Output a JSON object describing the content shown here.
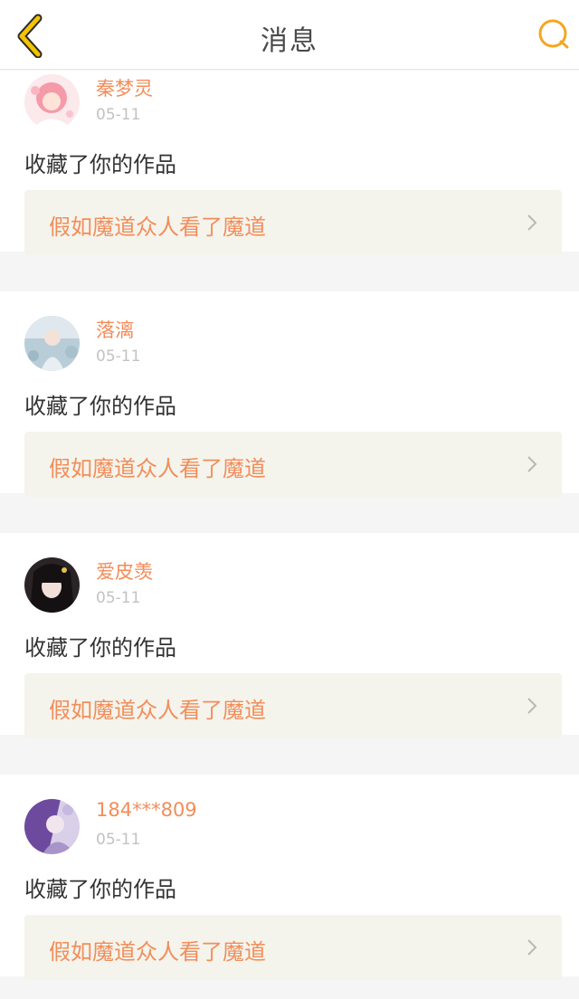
{
  "header": {
    "title": "消息",
    "back_icon": "chevron-left-icon",
    "search_icon": "search-icon",
    "accent_color": "#f5a623"
  },
  "colors": {
    "name": "#f28d5a",
    "work_title": "#f28d5a",
    "date": "#c2c2c2",
    "link_bg": "#f4f4ec",
    "page_bg": "#f5f5f5"
  },
  "messages": [
    {
      "user": "秦梦灵",
      "date": "05-11",
      "action": "收藏了你的作品",
      "work": "假如魔道众人看了魔道",
      "link_icon": "chevron-right-icon"
    },
    {
      "user": "落漓",
      "date": "05-11",
      "action": "收藏了你的作品",
      "work": "假如魔道众人看了魔道",
      "link_icon": "chevron-right-icon"
    },
    {
      "user": "爱皮羡",
      "date": "05-11",
      "action": "收藏了你的作品",
      "work": "假如魔道众人看了魔道",
      "link_icon": "chevron-right-icon"
    },
    {
      "user": "184***809",
      "date": "05-11",
      "action": "收藏了你的作品",
      "work": "假如魔道众人看了魔道",
      "link_icon": "chevron-right-icon"
    }
  ]
}
